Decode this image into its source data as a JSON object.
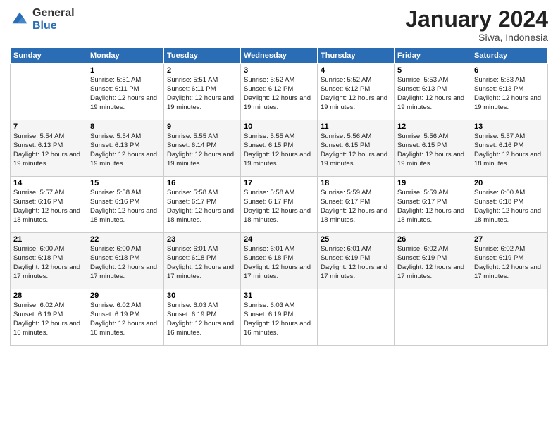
{
  "logo": {
    "general": "General",
    "blue": "Blue"
  },
  "header": {
    "month": "January 2024",
    "location": "Siwa, Indonesia"
  },
  "days_of_week": [
    "Sunday",
    "Monday",
    "Tuesday",
    "Wednesday",
    "Thursday",
    "Friday",
    "Saturday"
  ],
  "weeks": [
    [
      {
        "day": "",
        "sunrise": "",
        "sunset": "",
        "daylight": ""
      },
      {
        "day": "1",
        "sunrise": "Sunrise: 5:51 AM",
        "sunset": "Sunset: 6:11 PM",
        "daylight": "Daylight: 12 hours and 19 minutes."
      },
      {
        "day": "2",
        "sunrise": "Sunrise: 5:51 AM",
        "sunset": "Sunset: 6:11 PM",
        "daylight": "Daylight: 12 hours and 19 minutes."
      },
      {
        "day": "3",
        "sunrise": "Sunrise: 5:52 AM",
        "sunset": "Sunset: 6:12 PM",
        "daylight": "Daylight: 12 hours and 19 minutes."
      },
      {
        "day": "4",
        "sunrise": "Sunrise: 5:52 AM",
        "sunset": "Sunset: 6:12 PM",
        "daylight": "Daylight: 12 hours and 19 minutes."
      },
      {
        "day": "5",
        "sunrise": "Sunrise: 5:53 AM",
        "sunset": "Sunset: 6:13 PM",
        "daylight": "Daylight: 12 hours and 19 minutes."
      },
      {
        "day": "6",
        "sunrise": "Sunrise: 5:53 AM",
        "sunset": "Sunset: 6:13 PM",
        "daylight": "Daylight: 12 hours and 19 minutes."
      }
    ],
    [
      {
        "day": "7",
        "sunrise": "Sunrise: 5:54 AM",
        "sunset": "Sunset: 6:13 PM",
        "daylight": "Daylight: 12 hours and 19 minutes."
      },
      {
        "day": "8",
        "sunrise": "Sunrise: 5:54 AM",
        "sunset": "Sunset: 6:13 PM",
        "daylight": "Daylight: 12 hours and 19 minutes."
      },
      {
        "day": "9",
        "sunrise": "Sunrise: 5:55 AM",
        "sunset": "Sunset: 6:14 PM",
        "daylight": "Daylight: 12 hours and 19 minutes."
      },
      {
        "day": "10",
        "sunrise": "Sunrise: 5:55 AM",
        "sunset": "Sunset: 6:15 PM",
        "daylight": "Daylight: 12 hours and 19 minutes."
      },
      {
        "day": "11",
        "sunrise": "Sunrise: 5:56 AM",
        "sunset": "Sunset: 6:15 PM",
        "daylight": "Daylight: 12 hours and 19 minutes."
      },
      {
        "day": "12",
        "sunrise": "Sunrise: 5:56 AM",
        "sunset": "Sunset: 6:15 PM",
        "daylight": "Daylight: 12 hours and 19 minutes."
      },
      {
        "day": "13",
        "sunrise": "Sunrise: 5:57 AM",
        "sunset": "Sunset: 6:16 PM",
        "daylight": "Daylight: 12 hours and 18 minutes."
      }
    ],
    [
      {
        "day": "14",
        "sunrise": "Sunrise: 5:57 AM",
        "sunset": "Sunset: 6:16 PM",
        "daylight": "Daylight: 12 hours and 18 minutes."
      },
      {
        "day": "15",
        "sunrise": "Sunrise: 5:58 AM",
        "sunset": "Sunset: 6:16 PM",
        "daylight": "Daylight: 12 hours and 18 minutes."
      },
      {
        "day": "16",
        "sunrise": "Sunrise: 5:58 AM",
        "sunset": "Sunset: 6:17 PM",
        "daylight": "Daylight: 12 hours and 18 minutes."
      },
      {
        "day": "17",
        "sunrise": "Sunrise: 5:58 AM",
        "sunset": "Sunset: 6:17 PM",
        "daylight": "Daylight: 12 hours and 18 minutes."
      },
      {
        "day": "18",
        "sunrise": "Sunrise: 5:59 AM",
        "sunset": "Sunset: 6:17 PM",
        "daylight": "Daylight: 12 hours and 18 minutes."
      },
      {
        "day": "19",
        "sunrise": "Sunrise: 5:59 AM",
        "sunset": "Sunset: 6:17 PM",
        "daylight": "Daylight: 12 hours and 18 minutes."
      },
      {
        "day": "20",
        "sunrise": "Sunrise: 6:00 AM",
        "sunset": "Sunset: 6:18 PM",
        "daylight": "Daylight: 12 hours and 18 minutes."
      }
    ],
    [
      {
        "day": "21",
        "sunrise": "Sunrise: 6:00 AM",
        "sunset": "Sunset: 6:18 PM",
        "daylight": "Daylight: 12 hours and 17 minutes."
      },
      {
        "day": "22",
        "sunrise": "Sunrise: 6:00 AM",
        "sunset": "Sunset: 6:18 PM",
        "daylight": "Daylight: 12 hours and 17 minutes."
      },
      {
        "day": "23",
        "sunrise": "Sunrise: 6:01 AM",
        "sunset": "Sunset: 6:18 PM",
        "daylight": "Daylight: 12 hours and 17 minutes."
      },
      {
        "day": "24",
        "sunrise": "Sunrise: 6:01 AM",
        "sunset": "Sunset: 6:18 PM",
        "daylight": "Daylight: 12 hours and 17 minutes."
      },
      {
        "day": "25",
        "sunrise": "Sunrise: 6:01 AM",
        "sunset": "Sunset: 6:19 PM",
        "daylight": "Daylight: 12 hours and 17 minutes."
      },
      {
        "day": "26",
        "sunrise": "Sunrise: 6:02 AM",
        "sunset": "Sunset: 6:19 PM",
        "daylight": "Daylight: 12 hours and 17 minutes."
      },
      {
        "day": "27",
        "sunrise": "Sunrise: 6:02 AM",
        "sunset": "Sunset: 6:19 PM",
        "daylight": "Daylight: 12 hours and 17 minutes."
      }
    ],
    [
      {
        "day": "28",
        "sunrise": "Sunrise: 6:02 AM",
        "sunset": "Sunset: 6:19 PM",
        "daylight": "Daylight: 12 hours and 16 minutes."
      },
      {
        "day": "29",
        "sunrise": "Sunrise: 6:02 AM",
        "sunset": "Sunset: 6:19 PM",
        "daylight": "Daylight: 12 hours and 16 minutes."
      },
      {
        "day": "30",
        "sunrise": "Sunrise: 6:03 AM",
        "sunset": "Sunset: 6:19 PM",
        "daylight": "Daylight: 12 hours and 16 minutes."
      },
      {
        "day": "31",
        "sunrise": "Sunrise: 6:03 AM",
        "sunset": "Sunset: 6:19 PM",
        "daylight": "Daylight: 12 hours and 16 minutes."
      },
      {
        "day": "",
        "sunrise": "",
        "sunset": "",
        "daylight": ""
      },
      {
        "day": "",
        "sunrise": "",
        "sunset": "",
        "daylight": ""
      },
      {
        "day": "",
        "sunrise": "",
        "sunset": "",
        "daylight": ""
      }
    ]
  ]
}
